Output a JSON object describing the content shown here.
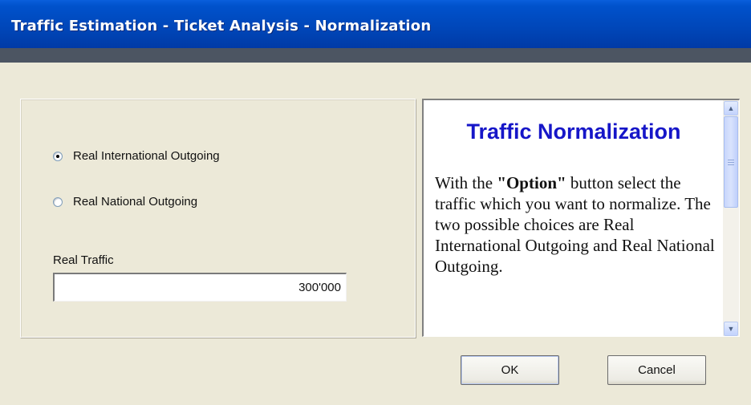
{
  "window": {
    "title": "Traffic Estimation - Ticket Analysis - Normalization"
  },
  "options": {
    "items": [
      {
        "label": "Real International Outgoing",
        "checked": true
      },
      {
        "label": "Real National Outgoing",
        "checked": false
      }
    ]
  },
  "real_traffic": {
    "label": "Real Traffic",
    "value": "300'000"
  },
  "help": {
    "heading": "Traffic Normalization",
    "body_before": "With the ",
    "body_bold": "\"Option\"",
    "body_after": " button select the traffic which you want to normalize.  The two possible choices are Real International Outgoing and Real National Outgoing."
  },
  "buttons": {
    "ok_label": "OK",
    "cancel_label": "Cancel"
  },
  "icons": {
    "scroll_up": "scroll-up-arrow-icon",
    "scroll_down": "scroll-down-arrow-icon"
  }
}
